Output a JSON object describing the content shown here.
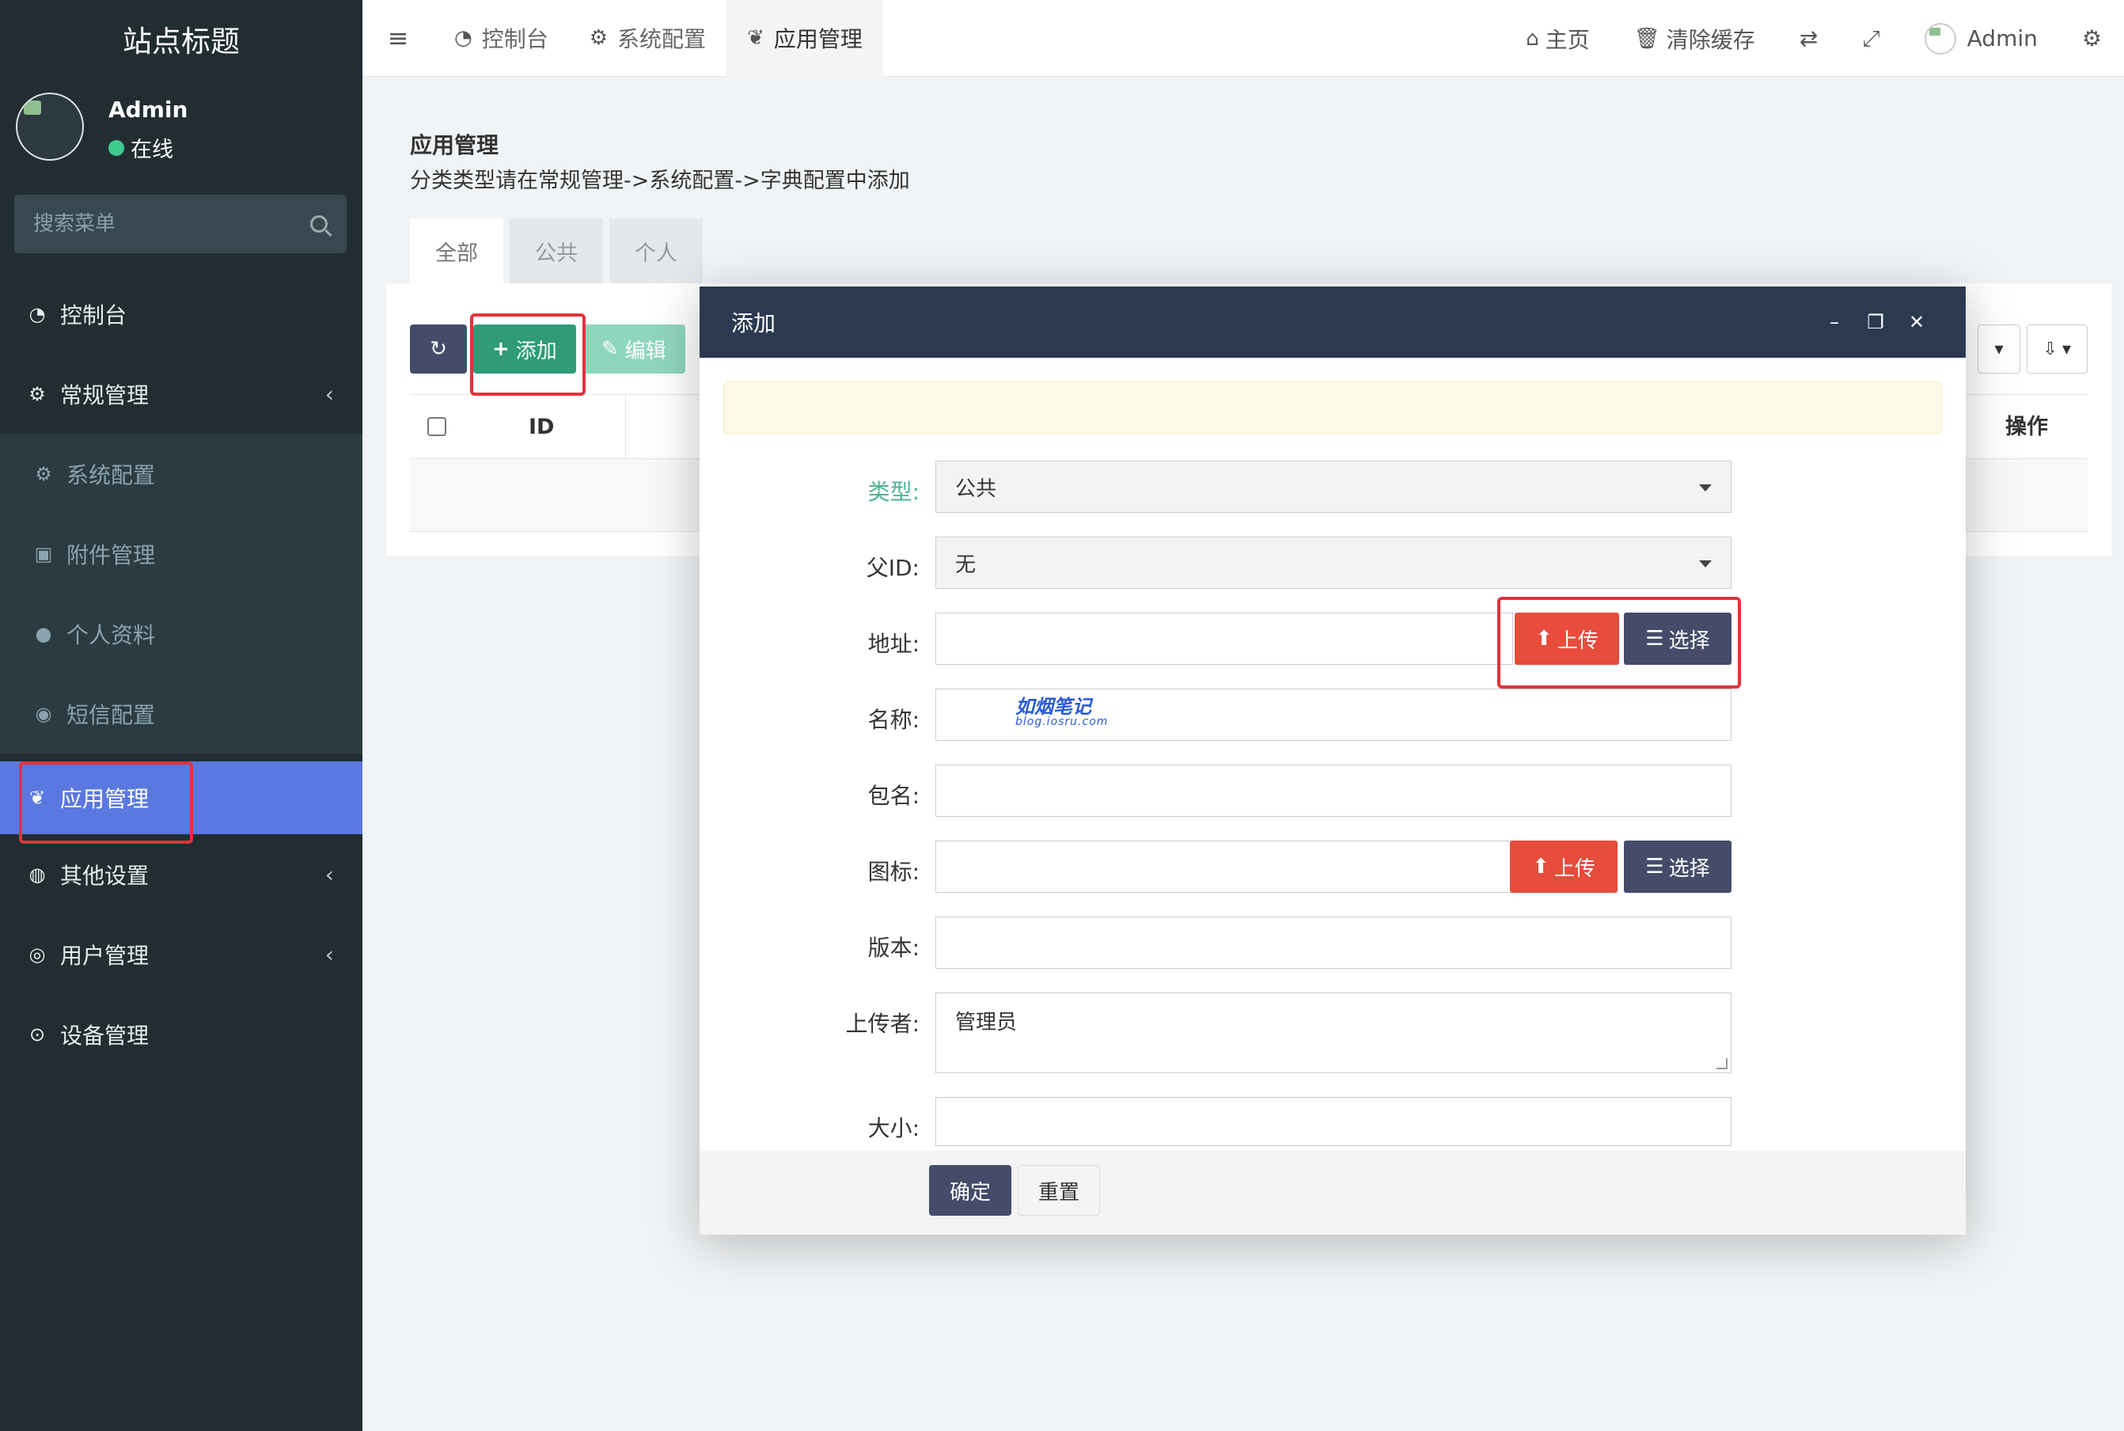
{
  "sidebar": {
    "logo": "站点标题",
    "user": {
      "name": "Admin",
      "status": "在线"
    },
    "search_placeholder": "搜索菜单",
    "items": [
      {
        "label": "控制台",
        "icon": "dashboard-icon",
        "glyph": "◔"
      },
      {
        "label": "常规管理",
        "icon": "cogs-icon",
        "glyph": "⚙",
        "chevron": "‹"
      },
      {
        "label": "系统配置",
        "icon": "gear-icon",
        "glyph": "⚙"
      },
      {
        "label": "附件管理",
        "icon": "image-file-icon",
        "glyph": "▣"
      },
      {
        "label": "个人资料",
        "icon": "user-icon",
        "glyph": "●"
      },
      {
        "label": "短信配置",
        "icon": "comments-icon",
        "glyph": "◉"
      },
      {
        "label": "应用管理",
        "icon": "leaf-icon",
        "glyph": "❦"
      },
      {
        "label": "其他设置",
        "icon": "users-icon",
        "glyph": "◍",
        "chevron": "‹"
      },
      {
        "label": "用户管理",
        "icon": "user-circle-icon",
        "glyph": "◎",
        "chevron": "‹"
      },
      {
        "label": "设备管理",
        "icon": "arrow-circle-icon",
        "glyph": "⊙"
      }
    ]
  },
  "navbar": {
    "toggle_glyph": "≡",
    "tabs": [
      {
        "label": "控制台",
        "glyph": "◔"
      },
      {
        "label": "系统配置",
        "glyph": "⚙"
      },
      {
        "label": "应用管理",
        "glyph": "❦"
      }
    ],
    "home": "主页",
    "home_glyph": "⌂",
    "clear_cache": "清除缓存",
    "trash_glyph": "🗑",
    "translate_glyph": "⇄",
    "fullscreen_glyph": "⤢",
    "admin": "Admin",
    "settings_glyph": "⚙"
  },
  "panel": {
    "title": "应用管理",
    "desc": "分类类型请在常规管理->系统配置->字典配置中添加",
    "tabs": [
      "全部",
      "公共",
      "个人"
    ],
    "refresh_glyph": "↻",
    "add": "添加",
    "add_glyph": "+",
    "edit": "编辑",
    "edit_glyph": "✎",
    "th_id": "ID",
    "th_op": "操作",
    "tool_glyph": "▾",
    "export_glyph": "⇩"
  },
  "modal": {
    "title": "添加",
    "minimize": "–",
    "maximize": "❐",
    "close": "✕",
    "fields": {
      "type_label": "类型:",
      "type_value": "公共",
      "parent_label": "父ID:",
      "parent_value": "无",
      "address_label": "地址:",
      "name_label": "名称:",
      "package_label": "包名:",
      "icon_label": "图标:",
      "version_label": "版本:",
      "uploader_label": "上传者:",
      "uploader_value": "管理员",
      "size_label": "大小:"
    },
    "upload": "上传",
    "upload_glyph": "⬆",
    "choose": "选择",
    "choose_glyph": "☰",
    "watermark": "如烟笔记",
    "watermark_url": "blog.iosru.com",
    "ok": "确定",
    "reset": "重置"
  }
}
